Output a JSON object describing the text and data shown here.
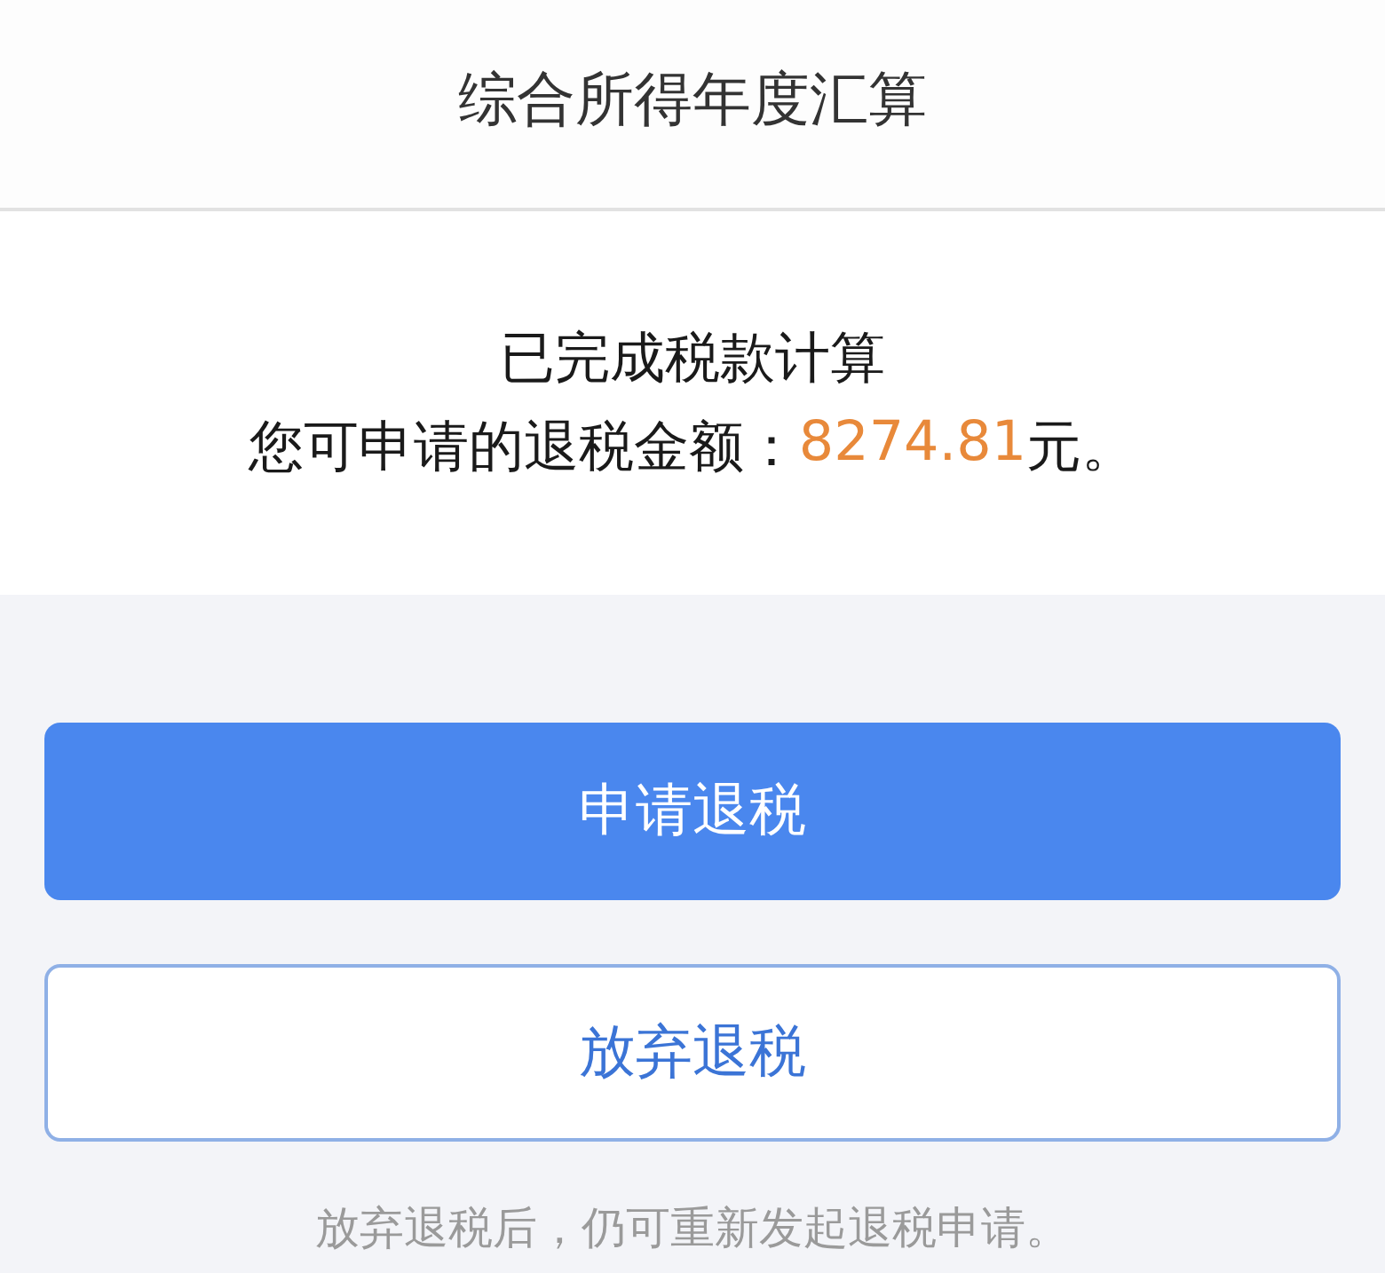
{
  "header": {
    "title": "综合所得年度汇算"
  },
  "result": {
    "heading": "已完成税款计算",
    "amount_label": "您可申请的退税金额：",
    "amount": "8274.81",
    "amount_suffix": "元。"
  },
  "buttons": [
    {
      "label": "申请退税",
      "kind": "primary"
    },
    {
      "label": "放弃退税",
      "kind": "secondary"
    }
  ],
  "note": "放弃退税后，仍可重新发起退税申请。"
}
